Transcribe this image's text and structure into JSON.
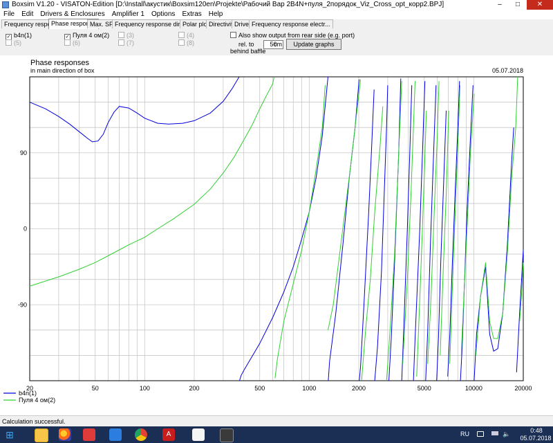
{
  "window": {
    "title": "Boxsim V1.20 - VISATON-Edition [D:\\Install\\акустик\\Boxsim120en\\Projekte\\Рабочий Вар 2B4N+пуля_2порядок_Viz_Cross_opt_корр2.BPJ]",
    "minimize": "–",
    "maximize": "□",
    "close": "✕"
  },
  "menu": [
    "File",
    "Edit",
    "Drivers & Enclosures",
    "Amplifier 1",
    "Options",
    "Extras",
    "Help"
  ],
  "tabs": [
    "Frequency response.",
    "Phase response",
    "Max. SPL",
    "Frequency response directions",
    "Polar plots",
    "Directivity",
    "Driver",
    "Frequency response electr..."
  ],
  "active_tab": 1,
  "controls": {
    "checkboxes": [
      {
        "label": "b4n(1)",
        "checked": true,
        "enabled": true
      },
      {
        "label": "Пуля 4 ом(2)",
        "checked": true,
        "enabled": true
      },
      {
        "label": "(3)",
        "checked": false,
        "enabled": false
      },
      {
        "label": "(4)",
        "checked": false,
        "enabled": false
      },
      {
        "label": "(5)",
        "checked": false,
        "enabled": false
      },
      {
        "label": "(6)",
        "checked": false,
        "enabled": false
      },
      {
        "label": "(7)",
        "checked": false,
        "enabled": false
      },
      {
        "label": "(8)",
        "checked": false,
        "enabled": false
      }
    ],
    "rear_side_label": "Also show output from rear side (e.g. port)",
    "rel_to": "rel. to",
    "behind_baffle": "behind baffle",
    "distance_value": "50",
    "distance_unit": "cm",
    "update_button": "Update graphs"
  },
  "chart_data": {
    "type": "line",
    "title": "Phase responses",
    "subtitle": "in main direction of box",
    "date": "05.07.2018",
    "x_scale": "log",
    "xlim": [
      20,
      20000
    ],
    "ylim": [
      -180,
      180
    ],
    "x_ticks": [
      20,
      50,
      100,
      200,
      500,
      1000,
      2000,
      5000,
      10000,
      20000
    ],
    "y_ticks": [
      90,
      0,
      -90
    ],
    "grid": true,
    "legend_position": "bottom-left",
    "series": [
      {
        "name": "b4n(1)",
        "color": "#0000e0",
        "points": [
          [
            20,
            150
          ],
          [
            25,
            142
          ],
          [
            30,
            133
          ],
          [
            35,
            124
          ],
          [
            40,
            115
          ],
          [
            45,
            107
          ],
          [
            48,
            103
          ],
          [
            52,
            104
          ],
          [
            56,
            112
          ],
          [
            60,
            126
          ],
          [
            65,
            138
          ],
          [
            70,
            145
          ],
          [
            80,
            143
          ],
          [
            90,
            137
          ],
          [
            100,
            131
          ],
          [
            120,
            125
          ],
          [
            140,
            124
          ],
          [
            170,
            125
          ],
          [
            200,
            128
          ],
          [
            250,
            137
          ],
          [
            300,
            151
          ],
          [
            340,
            166
          ],
          [
            375,
            180
          ],
          [
            377,
            -180
          ],
          [
            385,
            -174
          ],
          [
            400,
            -168
          ],
          [
            500,
            -136
          ],
          [
            600,
            -105
          ],
          [
            700,
            -75
          ],
          [
            800,
            -45
          ],
          [
            900,
            -12
          ],
          [
            1000,
            20
          ],
          [
            1100,
            60
          ],
          [
            1200,
            110
          ],
          [
            1300,
            180
          ],
          [
            1305,
            -180
          ],
          [
            1330,
            -157
          ],
          [
            1450,
            -100
          ],
          [
            1600,
            -20
          ],
          [
            1750,
            60
          ],
          [
            1900,
            120
          ],
          [
            2010,
            177
          ],
          [
            2015,
            -180
          ],
          [
            2050,
            -163
          ],
          [
            2150,
            -90
          ],
          [
            2300,
            20
          ],
          [
            2400,
            100
          ],
          [
            2480,
            165
          ],
          [
            2500,
            -180
          ],
          [
            2600,
            -140
          ],
          [
            2750,
            -50
          ],
          [
            2950,
            120
          ],
          [
            3000,
            170
          ],
          [
            3050,
            -180
          ],
          [
            3150,
            -130
          ],
          [
            3300,
            -40
          ],
          [
            3500,
            90
          ],
          [
            3600,
            178
          ],
          [
            3650,
            -180
          ],
          [
            3750,
            -120
          ],
          [
            3950,
            0
          ],
          [
            4100,
            100
          ],
          [
            4200,
            170
          ],
          [
            4300,
            -180
          ],
          [
            4400,
            -130
          ],
          [
            4700,
            0
          ],
          [
            4900,
            100
          ],
          [
            5050,
            175
          ],
          [
            5100,
            -180
          ],
          [
            5250,
            -120
          ],
          [
            5450,
            -20
          ],
          [
            5700,
            90
          ],
          [
            5900,
            170
          ],
          [
            5950,
            -180
          ],
          [
            6100,
            -130
          ],
          [
            6300,
            -40
          ],
          [
            6550,
            50
          ],
          [
            6800,
            140
          ],
          [
            6950,
            -175
          ],
          [
            7150,
            -125
          ],
          [
            7400,
            -45
          ],
          [
            7700,
            40
          ],
          [
            8000,
            120
          ],
          [
            8200,
            175
          ],
          [
            8300,
            -180
          ],
          [
            8500,
            -140
          ],
          [
            8800,
            -60
          ],
          [
            9100,
            20
          ],
          [
            9500,
            100
          ],
          [
            9900,
            170
          ],
          [
            10050,
            -180
          ],
          [
            10400,
            -125
          ],
          [
            11000,
            -80
          ],
          [
            11800,
            -45
          ],
          [
            12500,
            -125
          ],
          [
            13200,
            -145
          ],
          [
            14000,
            -142
          ],
          [
            15000,
            -100
          ],
          [
            16000,
            -20
          ],
          [
            17000,
            80
          ],
          [
            17500,
            120
          ],
          [
            18200,
            -170
          ],
          [
            19000,
            -100
          ],
          [
            20000,
            -25
          ]
        ]
      },
      {
        "name": "Пуля 4 ом(2)",
        "color": "#30d030",
        "points": [
          [
            20,
            -68
          ],
          [
            30,
            -57
          ],
          [
            40,
            -48
          ],
          [
            50,
            -40
          ],
          [
            60,
            -32
          ],
          [
            70,
            -25
          ],
          [
            80,
            -19
          ],
          [
            100,
            -10
          ],
          [
            120,
            0
          ],
          [
            150,
            12
          ],
          [
            200,
            29
          ],
          [
            250,
            47
          ],
          [
            300,
            66
          ],
          [
            350,
            85
          ],
          [
            400,
            105
          ],
          [
            450,
            123
          ],
          [
            500,
            142
          ],
          [
            550,
            158
          ],
          [
            600,
            172
          ],
          [
            610,
            179
          ],
          [
            620,
            -177
          ],
          [
            640,
            -155
          ],
          [
            700,
            -110
          ],
          [
            900,
            -25
          ],
          [
            1000,
            20
          ],
          [
            1100,
            70
          ],
          [
            1200,
            120
          ],
          [
            1250,
            170
          ],
          [
            1300,
            -120
          ],
          [
            1400,
            -90
          ],
          [
            1600,
            0
          ],
          [
            1800,
            80
          ],
          [
            1950,
            140
          ],
          [
            2050,
            177
          ],
          [
            2080,
            -180
          ],
          [
            2200,
            -120
          ],
          [
            2350,
            -60
          ],
          [
            2500,
            20
          ],
          [
            2700,
            100
          ],
          [
            2800,
            145
          ],
          [
            2950,
            -180
          ],
          [
            3100,
            -120
          ],
          [
            3300,
            -30
          ],
          [
            3500,
            90
          ],
          [
            3650,
            175
          ],
          [
            3700,
            -160
          ],
          [
            3950,
            -60
          ],
          [
            4150,
            40
          ],
          [
            4300,
            120
          ],
          [
            4400,
            175
          ],
          [
            4500,
            -175
          ],
          [
            4750,
            -60
          ],
          [
            5000,
            60
          ],
          [
            5150,
            140
          ],
          [
            5250,
            -160
          ],
          [
            5500,
            -80
          ],
          [
            5750,
            20
          ],
          [
            6000,
            110
          ],
          [
            6150,
            175
          ],
          [
            6250,
            -150
          ],
          [
            6550,
            -40
          ],
          [
            6800,
            40
          ],
          [
            7050,
            140
          ],
          [
            7150,
            -160
          ],
          [
            7450,
            -60
          ],
          [
            7750,
            30
          ],
          [
            8050,
            110
          ],
          [
            8250,
            170
          ],
          [
            8400,
            -150
          ],
          [
            8750,
            -70
          ],
          [
            9150,
            10
          ],
          [
            9550,
            90
          ],
          [
            10050,
            160
          ],
          [
            10300,
            -150
          ],
          [
            11000,
            -80
          ],
          [
            11800,
            -40
          ],
          [
            12500,
            -110
          ],
          [
            13200,
            -130
          ],
          [
            14000,
            -130
          ],
          [
            15000,
            -100
          ],
          [
            16000,
            -30
          ],
          [
            17000,
            60
          ],
          [
            18000,
            120
          ],
          [
            18500,
            180
          ],
          [
            19000,
            -110
          ],
          [
            19500,
            -80
          ],
          [
            20000,
            -40
          ]
        ]
      }
    ]
  },
  "status": "Calculation successful.",
  "taskbar": {
    "lang": "RU",
    "time": "0:48",
    "date": "05.07.2018"
  }
}
